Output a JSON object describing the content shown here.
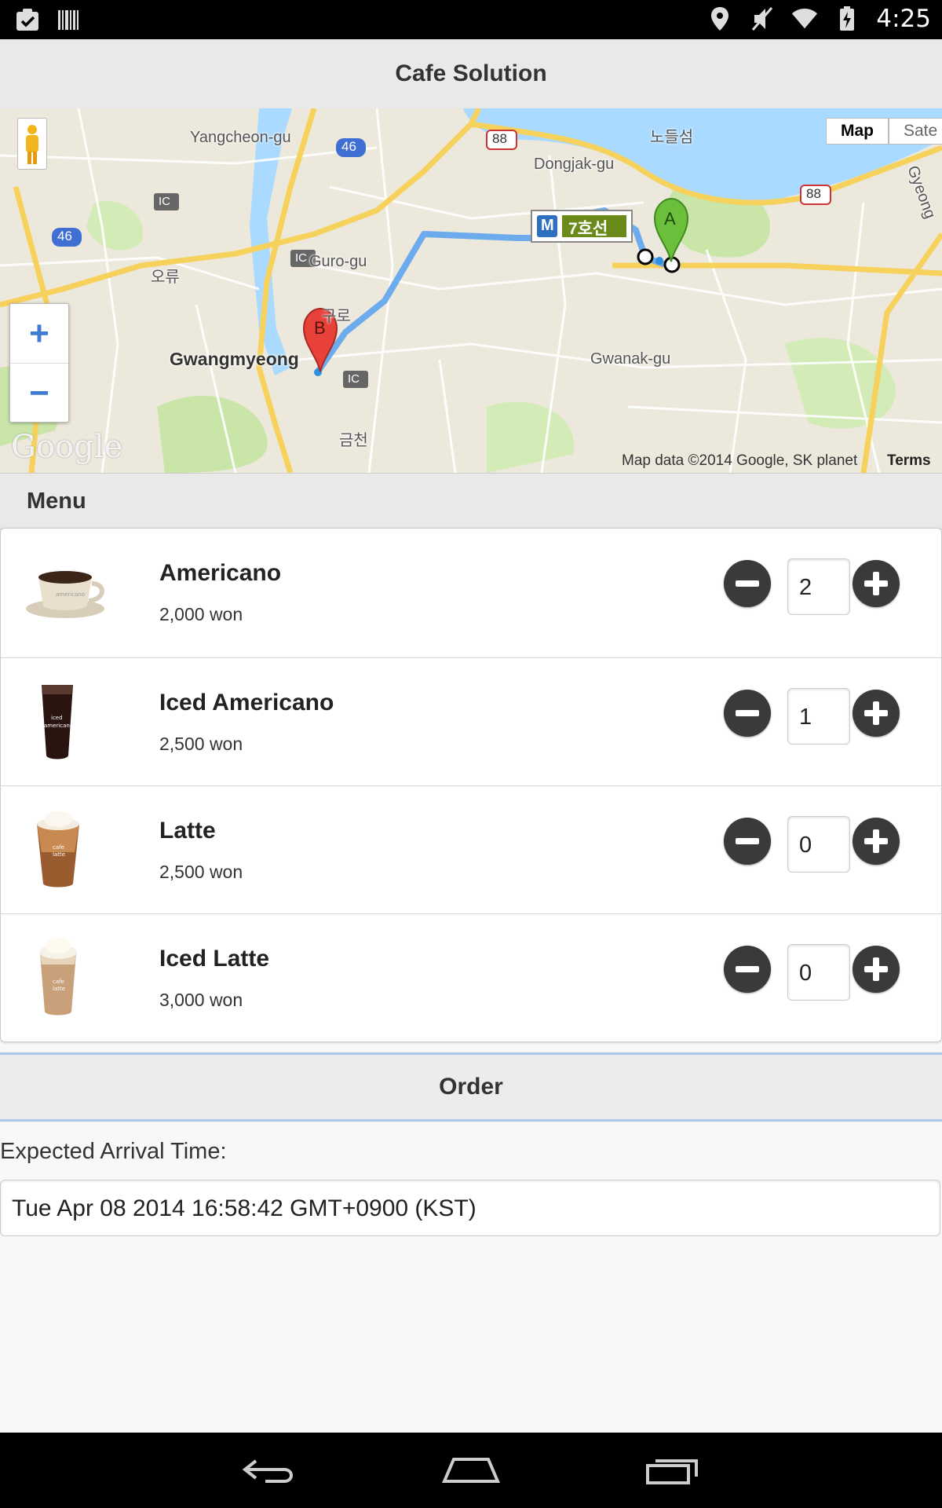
{
  "status_bar": {
    "time": "4:25",
    "left_icons": [
      "clipboard-check-icon",
      "barcode-icon"
    ],
    "right_icons": [
      "location-icon",
      "mute-icon",
      "wifi-icon",
      "battery-charging-icon"
    ]
  },
  "header": {
    "title": "Cafe Solution"
  },
  "map": {
    "labels": {
      "yangcheon": "Yangcheon-gu",
      "dongjak": "Dongjak-gu",
      "nodeulseom": "노들섬",
      "guro": "Guro-gu",
      "oryu": "오류",
      "guro_kr": "구로",
      "gwangmyeong": "Gwangmyeong",
      "gwanak": "Gwanak-gu",
      "geumcheon": "금천",
      "gyeonggi": "Gyeong",
      "road_88a": "88",
      "road_88b": "88",
      "road_46a": "46",
      "road_46b": "46",
      "ic1": "IC",
      "ic2": "IC",
      "ic3": "IC",
      "subway_m": "M",
      "subway_line": "7호선",
      "marker_a": "A",
      "marker_b": "B"
    },
    "zoom_in": "+",
    "zoom_out": "−",
    "type_map": "Map",
    "type_satellite": "Sate",
    "logo": "Google",
    "attribution": "Map data ©2014 Google, SK planet",
    "terms": "Terms o",
    "colors": {
      "water": "#aadaff",
      "park": "#c9e6a8",
      "route": "#5ea4ee",
      "highway": "#f6d15b",
      "marker_a": "#6bbf3a",
      "marker_b": "#e8413a"
    }
  },
  "menu": {
    "title": "Menu",
    "items": [
      {
        "name": "Americano",
        "price": "2,000 won",
        "qty": "2",
        "image": "hot-coffee-cup-icon"
      },
      {
        "name": "Iced Americano",
        "price": "2,500 won",
        "qty": "1",
        "image": "iced-americano-cup-icon"
      },
      {
        "name": "Latte",
        "price": "2,500 won",
        "qty": "0",
        "image": "latte-cup-icon"
      },
      {
        "name": "Iced Latte",
        "price": "3,000 won",
        "qty": "0",
        "image": "iced-latte-cup-icon"
      }
    ],
    "cup_labels": {
      "americano": "americano",
      "iced": "iced",
      "cafe": "cafe",
      "latte": "latte"
    }
  },
  "order": {
    "label": "Order"
  },
  "arrival": {
    "label": "Expected Arrival Time:",
    "value": "Tue Apr 08 2014 16:58:42 GMT+0900 (KST)"
  },
  "nav": {
    "icons": [
      "back-icon",
      "home-icon",
      "recents-icon"
    ]
  }
}
